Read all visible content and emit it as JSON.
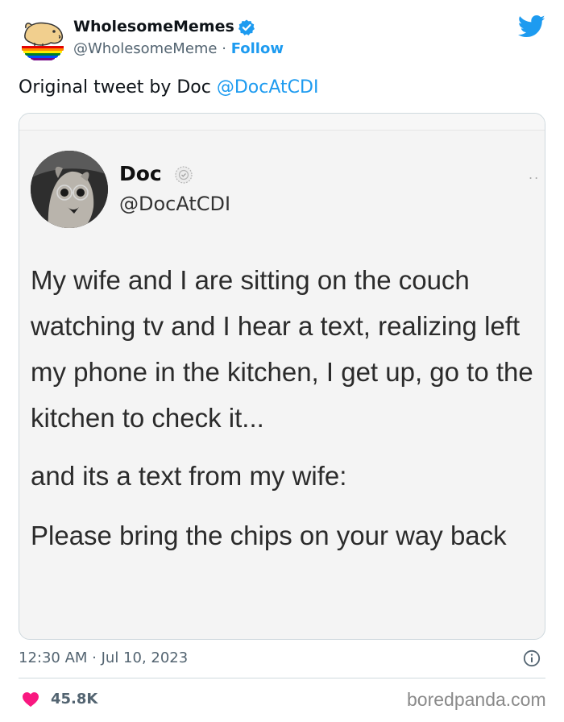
{
  "header": {
    "display_name": "WholesomeMemes",
    "handle": "@WholesomeMeme",
    "separator": " · ",
    "follow_label": "Follow"
  },
  "tweet": {
    "text_prefix": "Original tweet by Doc ",
    "mention": "@DocAtCDI"
  },
  "embedded": {
    "name": "Doc",
    "handle": "@DocAtCDI",
    "dots": "..",
    "paragraph1": "My wife and I are sitting on the couch watching tv and I hear a text, realizing left my phone in the kitchen, I get up, go to the kitchen to check it...",
    "paragraph2": "and its a text from my wife:",
    "paragraph3": "Please bring the chips on your way back"
  },
  "footer": {
    "timestamp": "12:30 AM · Jul 10, 2023",
    "likes": "45.8K",
    "watermark": "boredpanda.com"
  },
  "colors": {
    "accent": "#1d9bf0",
    "heart": "#f91880",
    "muted": "#536471"
  },
  "icons": [
    "verified-badge-icon",
    "twitter-bird-icon",
    "info-icon",
    "heart-icon"
  ]
}
